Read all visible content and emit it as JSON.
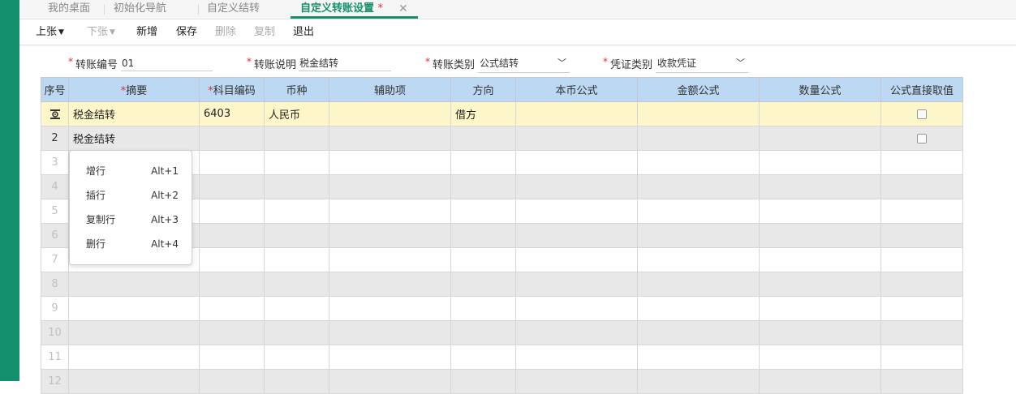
{
  "tabs": [
    {
      "label": "我的桌面"
    },
    {
      "label": "初始化导航"
    },
    {
      "label": "自定义结转"
    },
    {
      "label": "自定义转账设置",
      "modified": "*"
    }
  ],
  "toolbar": {
    "prev": "上张",
    "next": "下张",
    "add": "新增",
    "save": "保存",
    "delete": "删除",
    "copy": "复制",
    "exit": "退出"
  },
  "form": {
    "required_mark": "*",
    "code_label": "转账编号",
    "code_value": "01",
    "desc_label": "转账说明",
    "desc_value": "税金结转",
    "type_label": "转账类别",
    "type_value": "公式结转",
    "voucher_label": "凭证类别",
    "voucher_value": "收款凭证"
  },
  "grid": {
    "headers": {
      "idx": "序号",
      "summary": "摘要",
      "account": "科目编码",
      "currency": "币种",
      "aux": "辅助项",
      "direction": "方向",
      "local_formula": "本币公式",
      "amount_formula": "金额公式",
      "qty_formula": "数量公式",
      "direct": "公式直接取值"
    },
    "rows": [
      {
        "idx": "",
        "summary": "税金结转",
        "account": "6403",
        "currency": "人民币",
        "aux": "",
        "direction": "借方"
      },
      {
        "idx": "2",
        "summary": "税金结转",
        "account": "",
        "currency": "",
        "aux": "",
        "direction": ""
      },
      {
        "idx": "3"
      },
      {
        "idx": "4"
      },
      {
        "idx": "5"
      },
      {
        "idx": "6"
      },
      {
        "idx": "7"
      },
      {
        "idx": "8"
      },
      {
        "idx": "9"
      },
      {
        "idx": "10"
      },
      {
        "idx": "11"
      },
      {
        "idx": "12"
      }
    ]
  },
  "context_menu": [
    {
      "label": "增行",
      "key": "Alt+1"
    },
    {
      "label": "插行",
      "key": "Alt+2"
    },
    {
      "label": "复制行",
      "key": "Alt+3"
    },
    {
      "label": "删行",
      "key": "Alt+4"
    }
  ],
  "colors": {
    "brand": "#14906e",
    "header_bg": "#bcd8f2",
    "selected_row": "#fdf6c8",
    "required": "#e03030"
  }
}
